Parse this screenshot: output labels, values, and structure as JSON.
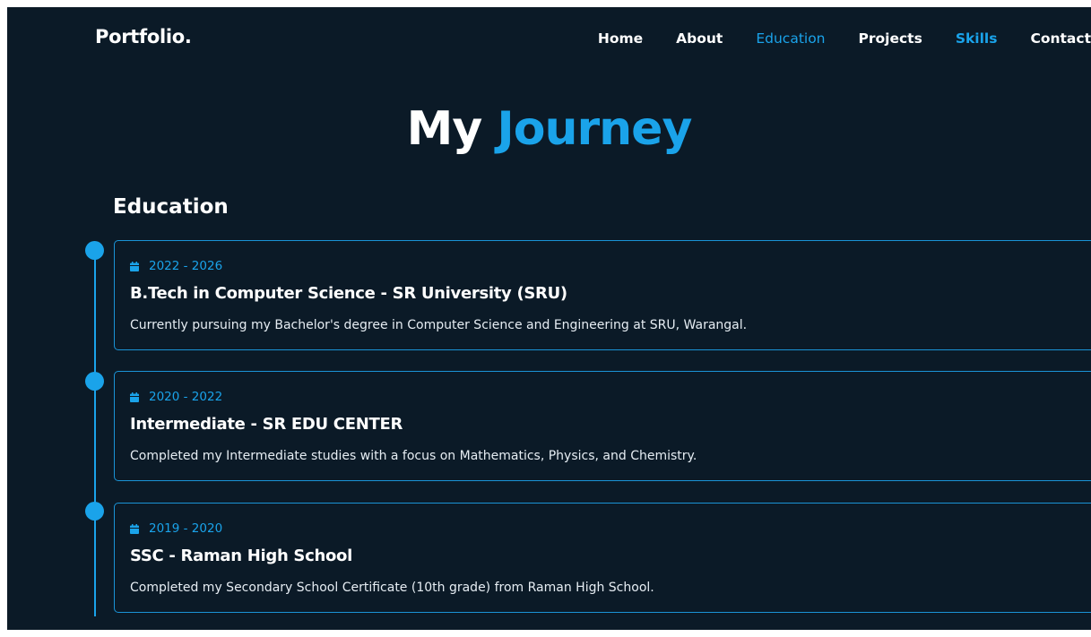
{
  "nav": {
    "logo": "Portfolio.",
    "links": [
      {
        "label": "Home",
        "state": "normal"
      },
      {
        "label": "About",
        "state": "normal"
      },
      {
        "label": "Education",
        "state": "active"
      },
      {
        "label": "Projects",
        "state": "normal"
      },
      {
        "label": "Skills",
        "state": "highlight"
      },
      {
        "label": "Contact",
        "state": "normal"
      }
    ]
  },
  "hero": {
    "title_plain": "My",
    "title_accent": "Journey"
  },
  "section": {
    "title": "Education"
  },
  "education": [
    {
      "date": "2022 - 2026",
      "title": "B.Tech in Computer Science - SR University (SRU)",
      "description": "Currently pursuing my Bachelor's degree in Computer Science and Engineering at SRU, Warangal."
    },
    {
      "date": "2020 - 2022",
      "title": "Intermediate - SR EDU CENTER",
      "description": "Completed my Intermediate studies with a focus on Mathematics, Physics, and Chemistry."
    },
    {
      "date": "2019 - 2020",
      "title": "SSC - Raman High School",
      "description": "Completed my Secondary School Certificate (10th grade) from Raman High School."
    }
  ],
  "colors": {
    "background": "#0b1a27",
    "accent": "#1aa3ea",
    "text": "#ffffff"
  },
  "icons": {
    "date": "calendar-icon"
  }
}
